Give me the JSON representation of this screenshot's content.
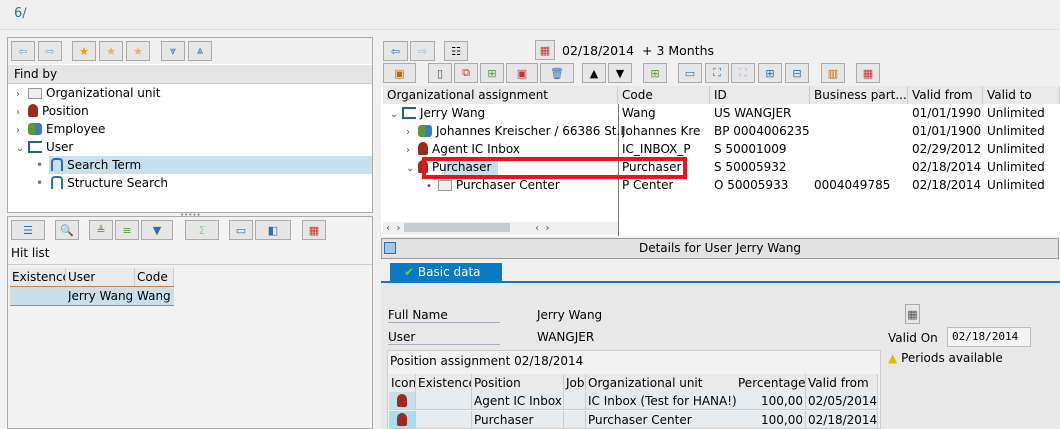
{
  "left": {
    "find_by": "Find by",
    "tree": [
      {
        "label": "Organizational unit",
        "icon": "org-unit-icon",
        "expander": "›"
      },
      {
        "label": "Position",
        "icon": "position-icon",
        "expander": "›"
      },
      {
        "label": "Employee",
        "icon": "employee-icon",
        "expander": "›"
      },
      {
        "label": "User",
        "icon": "user-icon",
        "expander": "⌄"
      },
      {
        "label": "Search Term",
        "icon": "binoculars-icon"
      },
      {
        "label": "Structure Search",
        "icon": "binoculars-icon"
      }
    ],
    "hit_list": "Hit list",
    "hit_columns": [
      "Existence",
      "User",
      "Code"
    ],
    "hit_rows": [
      [
        "",
        "Jerry Wang",
        "Wang"
      ]
    ]
  },
  "right": {
    "date_range": "02/18/2014  + 3 Months",
    "columns": [
      "Organizational assignment",
      "Code",
      "ID",
      "Business part...",
      "Valid from",
      "Valid to"
    ],
    "rows": [
      {
        "name": "Jerry Wang",
        "code": "Wang",
        "id": "US WANGJER",
        "bp": "",
        "from": "01/01/1990",
        "to": "Unlimited"
      },
      {
        "name": "Johannes Kreischer / 66386 St.I",
        "code": "Johannes Kre",
        "id": "BP 0004006235",
        "bp": "",
        "from": "01/01/1900",
        "to": "Unlimited"
      },
      {
        "name": "Agent IC Inbox",
        "code": "IC_INBOX_P",
        "id": "S  50001009",
        "bp": "",
        "from": "02/29/2012",
        "to": "Unlimited"
      },
      {
        "name": "Purchaser",
        "code": "Purchaser",
        "id": "S  50005932",
        "bp": "",
        "from": "02/18/2014",
        "to": "Unlimited"
      },
      {
        "name": "Purchaser Center",
        "code": "P Center",
        "id": "O  50005933",
        "bp": "0004049785",
        "from": "02/18/2014",
        "to": "Unlimited"
      }
    ],
    "details_title": "Details for User Jerry Wang",
    "tab_basic": "Basic data",
    "full_name_label": "Full Name",
    "full_name": "Jerry Wang",
    "user_label": "User",
    "user": "WANGJER",
    "valid_on_label": "Valid On",
    "valid_on": "02/18/2014",
    "periods": "Periods available",
    "pos_title": "Position assignment 02/18/2014",
    "pos_columns": [
      "Icon",
      "Existence",
      "Position",
      "Job",
      "Organizational unit",
      "Percentage",
      "Valid from"
    ],
    "pos_rows": [
      [
        "",
        "",
        "Agent IC Inbox",
        "",
        "IC Inbox (Test for HANA!)",
        "100,00",
        "02/05/2014"
      ],
      [
        "",
        "",
        "Purchaser",
        "",
        "Purchaser Center",
        "100,00",
        "02/18/2014"
      ]
    ]
  },
  "colors": {
    "highlight": "#e8141c",
    "select": "#c8e0ee",
    "tab": "#0a7bc2"
  }
}
